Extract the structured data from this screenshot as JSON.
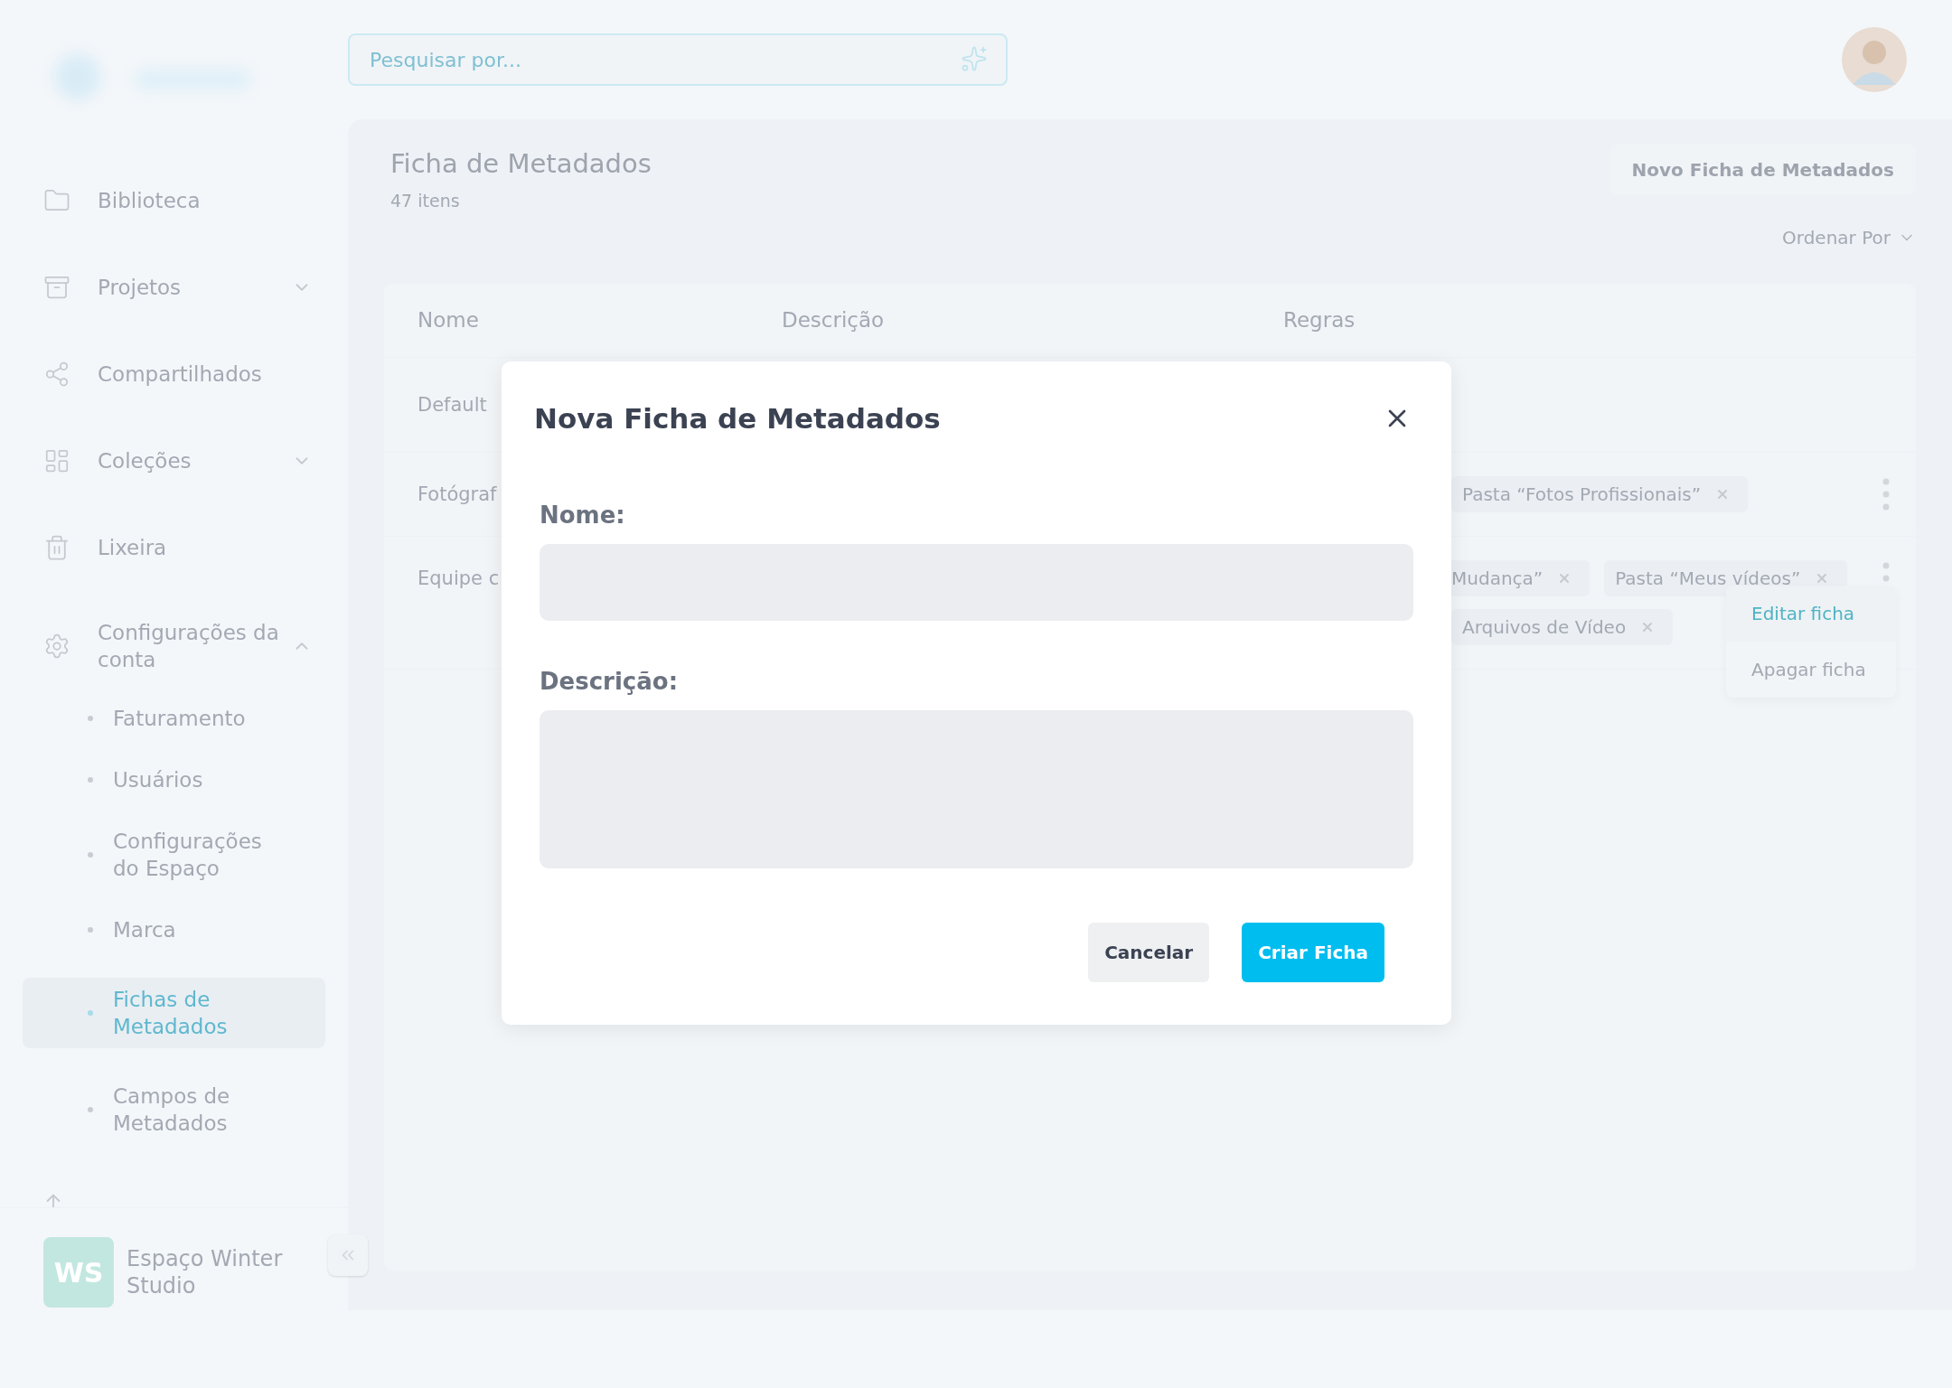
{
  "search": {
    "placeholder": "Pesquisar por..."
  },
  "sidebar": {
    "items": [
      {
        "label": "Biblioteca",
        "kind": "link",
        "selected": false
      },
      {
        "label": "Projetos",
        "kind": "group",
        "expanded": false,
        "selected": false
      },
      {
        "label": "Compartilhados",
        "kind": "link",
        "selected": false
      },
      {
        "label": "Coleções",
        "kind": "group",
        "expanded": false,
        "selected": false
      },
      {
        "label": "Lixeira",
        "kind": "link",
        "selected": false
      },
      {
        "label": "Configurações da conta",
        "kind": "group",
        "expanded": true,
        "selected": false,
        "children": [
          {
            "label": "Faturamento",
            "selected": false
          },
          {
            "label": "Usuários",
            "selected": false
          },
          {
            "label": "Configurações do Espaço",
            "selected": false
          },
          {
            "label": "Marca",
            "selected": false
          },
          {
            "label": "Fichas de Metadados",
            "selected": true
          },
          {
            "label": "Campos de Metadados",
            "selected": false
          }
        ]
      }
    ]
  },
  "workspace": {
    "initials": "WS",
    "name": "Espaço Winter Studio"
  },
  "page": {
    "title": "Ficha de Metadados",
    "count": "47 itens",
    "new_button": "Novo Ficha de Metadados",
    "sort_label": "Ordenar Por"
  },
  "table": {
    "columns": [
      "Nome",
      "Descrição",
      "Regras"
    ],
    "rows": [
      {
        "name": "Default"
      },
      {
        "name": "Fotógraf",
        "rules": [
          "Pasta “Fotos Profissionais”"
        ]
      },
      {
        "name": "Equipe c",
        "rules": [
          "Mudança”",
          "Pasta “Meus vídeos”",
          "Arquivos de Vídeo"
        ],
        "menu": [
          {
            "label": "Editar ficha",
            "selected": true
          },
          {
            "label": "Apagar ficha",
            "selected": false
          }
        ]
      }
    ]
  },
  "modal": {
    "title": "Nova Ficha de Metadados",
    "fields": [
      {
        "label": "Nome:",
        "kind": "input"
      },
      {
        "label": "Descrição:",
        "kind": "textarea"
      }
    ],
    "buttons": [
      {
        "label": "Cancelar",
        "kind": "secondary"
      },
      {
        "label": "Criar Ficha",
        "kind": "primary"
      }
    ]
  }
}
